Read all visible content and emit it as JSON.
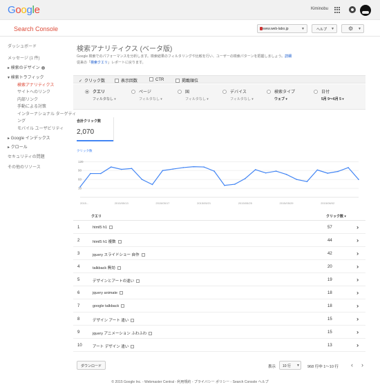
{
  "topbar": {
    "logo": "Google",
    "user": "Kiminobu"
  },
  "header": {
    "title": "Search Console",
    "site": "www.web-labo.jp",
    "help": "ヘルプ"
  },
  "sidebar": [
    {
      "label": "ダッシュボード",
      "style": "plain"
    },
    {
      "label": "メッセージ (1 件)",
      "style": "plain"
    },
    {
      "label": "▸ 検索のデザイン",
      "style": "dark",
      "info": "i"
    },
    {
      "label": "▾ 検索トラフィック",
      "style": "dark"
    },
    {
      "label": "検索アナリティクス",
      "style": "red",
      "indent": true
    },
    {
      "label": "サイトへのリンク",
      "style": "plain",
      "indent": true
    },
    {
      "label": "内部リンク",
      "style": "plain",
      "indent": true
    },
    {
      "label": "手動による対策",
      "style": "plain",
      "indent": true
    },
    {
      "label": "インターナショナル ターゲティ",
      "style": "plain",
      "indent": true
    },
    {
      "label": "ング",
      "style": "plain",
      "indent": true
    },
    {
      "label": "モバイル ユーザビリティ",
      "style": "plain",
      "indent": true
    },
    {
      "label": "▸ Google インデックス",
      "style": "dark"
    },
    {
      "label": "▸ クロール",
      "style": "dark"
    },
    {
      "label": "セキュリティの問題",
      "style": "plain"
    },
    {
      "label": "その他のリソース",
      "style": "plain"
    }
  ],
  "main": {
    "title": "検索アナリティクス (ベータ版)",
    "desc1": "Google 検索でのパフォーマンスを分析します。検索結果のフィルタリングや比較を行い、ユーザーの検索パターンを把握しましょう。",
    "desc1_link": "詳細",
    "desc2_pre": "従来の「",
    "desc2_link": "検索クエリ",
    "desc2_post": "」レポートに戻ります。"
  },
  "metrics": [
    {
      "label": "クリック数",
      "checked": true
    },
    {
      "label": "表示回数",
      "checked": false
    },
    {
      "label": "CTR",
      "checked": false
    },
    {
      "label": "掲載順位",
      "checked": false
    }
  ],
  "dimensions": [
    {
      "label": "クエリ",
      "filter": "フィルタなし ▾",
      "selected": true,
      "bold_filter": false
    },
    {
      "label": "ページ",
      "filter": "フィルタなし ▾",
      "selected": false,
      "bold_filter": false
    },
    {
      "label": "国",
      "filter": "フィルタなし ▾",
      "selected": false,
      "bold_filter": false
    },
    {
      "label": "デバイス",
      "filter": "フィルタなし ▾",
      "selected": false,
      "bold_filter": false
    },
    {
      "label": "検索タイプ",
      "filter": "ウェブ ▾",
      "selected": false,
      "bold_filter": true
    },
    {
      "label": "日付",
      "filter": "5月 9〜6月 5 ▾",
      "selected": false,
      "bold_filter": true
    }
  ],
  "totals": {
    "label": "合計クリック数",
    "value": "2,070"
  },
  "chart_data": {
    "type": "line",
    "ylabel": "クリック数",
    "yticks": [
      30,
      60,
      90,
      120
    ],
    "ylim": [
      0,
      130
    ],
    "xticks": [
      "2015...",
      "2015/05/13",
      "2015/05/17",
      "2015/05/21",
      "2015/05/25",
      "2015/05/29",
      "2015/06/02"
    ],
    "series": [
      {
        "name": "クリック数",
        "color": "#4285f4",
        "values": [
          35,
          80,
          80,
          102,
          94,
          97,
          60,
          43,
          90,
          95,
          100,
          103,
          102,
          88,
          40,
          44,
          63,
          93,
          82,
          88,
          77,
          60,
          53,
          92,
          81,
          87,
          100,
          60
        ]
      }
    ]
  },
  "table": {
    "col_query": "クエリ",
    "col_clicks": "クリック数 ▾",
    "rows": [
      {
        "n": "1",
        "q": "html5 h1",
        "c": "57"
      },
      {
        "n": "2",
        "q": "html5 h1 複数",
        "c": "44"
      },
      {
        "n": "3",
        "q": "jquery スライドショー 自作",
        "c": "42"
      },
      {
        "n": "4",
        "q": "talkback 無効",
        "c": "20"
      },
      {
        "n": "5",
        "q": "デザインとアートの違い",
        "c": "19"
      },
      {
        "n": "6",
        "q": "jquery animate",
        "c": "18"
      },
      {
        "n": "7",
        "q": "google talkback",
        "c": "18"
      },
      {
        "n": "8",
        "q": "デザイン アート 違い",
        "c": "15"
      },
      {
        "n": "9",
        "q": "jquery アニメーション ふわふわ",
        "c": "15"
      },
      {
        "n": "10",
        "q": "アート デザイン 違い",
        "c": "13"
      }
    ]
  },
  "bottom": {
    "download": "ダウンロード",
    "show": "表示",
    "rows_sel": "10 行",
    "range": "968 行中 1〜10 行"
  },
  "footer": "© 2015 Google Inc. - Webmaster Central - 利用規約 - プライバシー ポリシー - Search Console ヘルプ"
}
